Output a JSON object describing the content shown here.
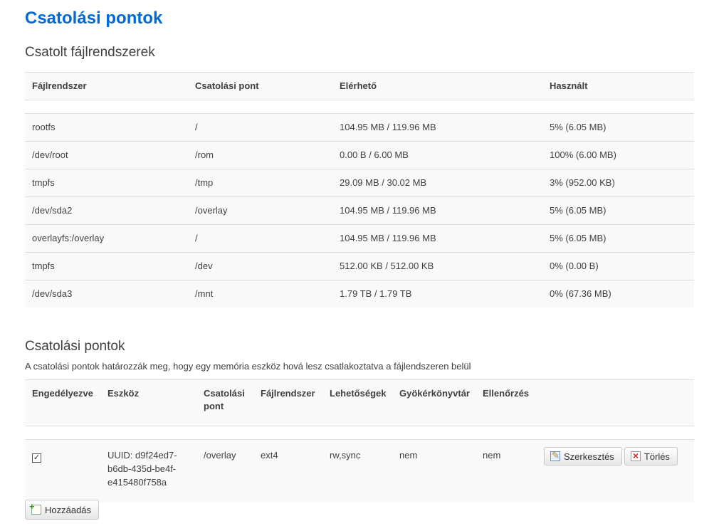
{
  "page": {
    "title": "Csatolási pontok"
  },
  "mounted": {
    "title": "Csatolt fájlrendszerek",
    "columns": [
      "Fájlrendszer",
      "Csatolási pont",
      "Elérhető",
      "Használt"
    ],
    "rows": [
      [
        "rootfs",
        "/",
        "104.95 MB / 119.96 MB",
        "5% (6.05 MB)"
      ],
      [
        "/dev/root",
        "/rom",
        "0.00 B / 6.00 MB",
        "100% (6.00 MB)"
      ],
      [
        "tmpfs",
        "/tmp",
        "29.09 MB / 30.02 MB",
        "3% (952.00 KB)"
      ],
      [
        "/dev/sda2",
        "/overlay",
        "104.95 MB / 119.96 MB",
        "5% (6.05 MB)"
      ],
      [
        "overlayfs:/overlay",
        "/",
        "104.95 MB / 119.96 MB",
        "5% (6.05 MB)"
      ],
      [
        "tmpfs",
        "/dev",
        "512.00 KB / 512.00 KB",
        "0% (0.00 B)"
      ],
      [
        "/dev/sda3",
        "/mnt",
        "1.79 TB / 1.79 TB",
        "0% (67.36 MB)"
      ]
    ]
  },
  "mounts": {
    "title": "Csatolási pontok",
    "description": "A csatolási pontok határozzák meg, hogy egy memória eszköz hová lesz csatlakoztatva a fájlendszeren belül",
    "columns": [
      "Engedélyezve",
      "Eszköz",
      "Csatolási pont",
      "Fájlrendszer",
      "Lehetőségek",
      "Gyökérkönyvtár",
      "Ellenőrzés"
    ],
    "row": {
      "enabled": true,
      "device": "UUID: d9f24ed7-b6db-435d-be4f-e415480f758a",
      "mountpoint": "/overlay",
      "fs": "ext4",
      "options": "rw,sync",
      "root": "nem",
      "check": "nem",
      "edit_label": "Szerkesztés",
      "delete_label": "Törlés"
    },
    "add_label": "Hozzáadás"
  }
}
